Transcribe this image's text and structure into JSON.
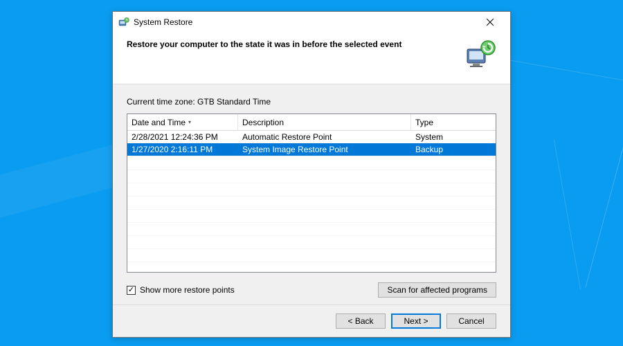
{
  "window": {
    "title": "System Restore"
  },
  "header": {
    "title": "Restore your computer to the state it was in before the selected event"
  },
  "content": {
    "timezone_label": "Current time zone: GTB Standard Time",
    "columns": {
      "date": "Date and Time",
      "description": "Description",
      "type": "Type"
    },
    "rows": [
      {
        "date": "2/28/2021 12:24:36 PM",
        "description": "Automatic Restore Point",
        "type": "System",
        "selected": false
      },
      {
        "date": "1/27/2020 2:16:11 PM",
        "description": "System Image Restore Point",
        "type": "Backup",
        "selected": true
      }
    ],
    "show_more_label": "Show more restore points",
    "show_more_checked": true,
    "scan_button_label": "Scan for affected programs"
  },
  "footer": {
    "back_label": "< Back",
    "next_label": "Next >",
    "cancel_label": "Cancel"
  }
}
